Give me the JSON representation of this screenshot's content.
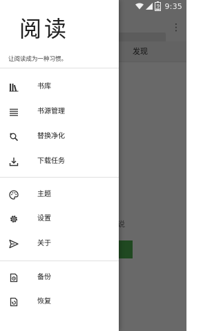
{
  "status_bar": {
    "time": "9:35",
    "battery_level": "9",
    "icons": [
      "wifi-icon",
      "signal-icon",
      "battery-icon"
    ]
  },
  "background_app": {
    "tab_discover": "发现",
    "empty_hint_fragment": "说"
  },
  "drawer": {
    "logo_text": "阅读",
    "slogan": "让阅读成为一种习惯。",
    "groups": [
      [
        {
          "label": "书库",
          "icon": "bookshelf-icon"
        },
        {
          "label": "书源管理",
          "icon": "list-icon"
        },
        {
          "label": "替换净化",
          "icon": "replace-icon"
        },
        {
          "label": "下载任务",
          "icon": "download-icon"
        }
      ],
      [
        {
          "label": "主题",
          "icon": "palette-icon"
        },
        {
          "label": "设置",
          "icon": "settings-icon"
        },
        {
          "label": "关于",
          "icon": "send-icon"
        }
      ],
      [
        {
          "label": "备份",
          "icon": "backup-icon"
        },
        {
          "label": "恢复",
          "icon": "restore-icon"
        }
      ]
    ]
  },
  "colors": {
    "accent_green": "#4caf50",
    "drawer_bg": "#ffffff",
    "scrim": "rgba(0,0,0,0.58)"
  }
}
